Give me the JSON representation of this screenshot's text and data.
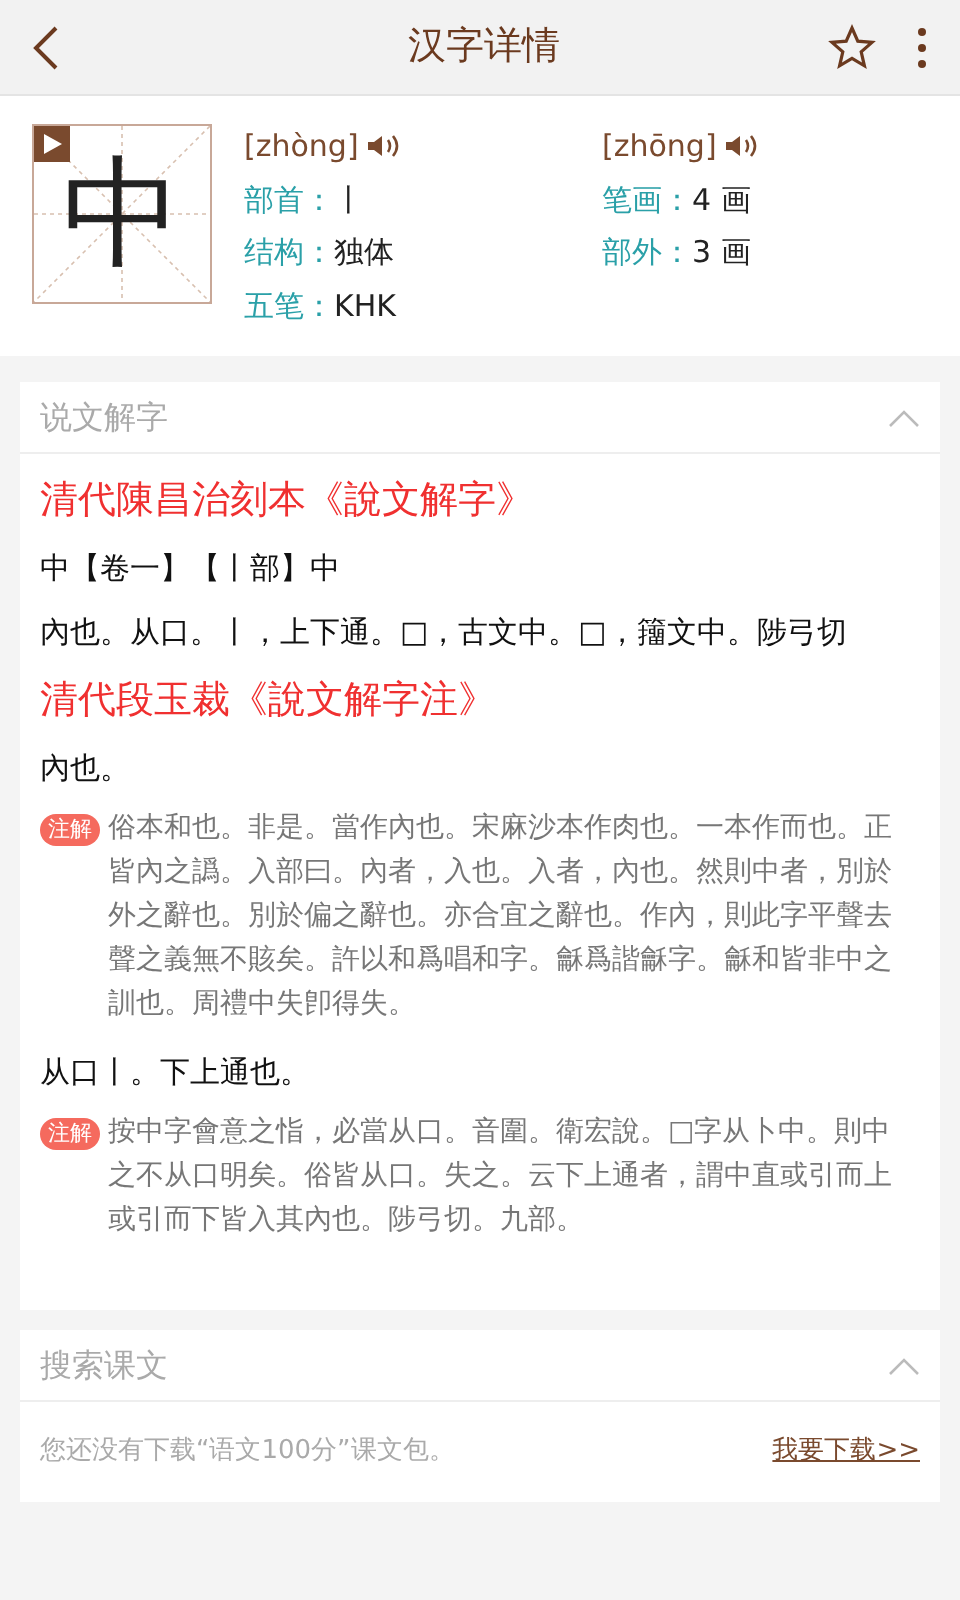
{
  "header": {
    "title": "汉字详情"
  },
  "character": {
    "glyph": "中",
    "pronunciations": [
      {
        "pinyin": "[zhòng]"
      },
      {
        "pinyin": "[zhōng]"
      }
    ],
    "fields": [
      {
        "label": "部首：",
        "value": "丨"
      },
      {
        "label": "笔画：",
        "value": "4 画"
      },
      {
        "label": "结构：",
        "value": "独体"
      },
      {
        "label": "部外：",
        "value": "3 画"
      },
      {
        "label": "五笔：",
        "value": "KHK"
      }
    ]
  },
  "shuowen": {
    "title": "说文解字",
    "expanded": true,
    "blocks": [
      {
        "kind": "heading",
        "text": "清代陳昌治刻本《說文解字》"
      },
      {
        "kind": "text",
        "text": "中【卷一】【丨部】中"
      },
      {
        "kind": "text",
        "text": "內也。从口。丨，上下通。□，古文中。□，籒文中。陟弓切"
      },
      {
        "kind": "heading",
        "text": "清代段玉裁《說文解字注》"
      },
      {
        "kind": "text",
        "text": "內也。"
      },
      {
        "kind": "note",
        "badge": "注解",
        "text": "俗本和也。非是。當作內也。宋麻沙本作肉也。一本作而也。正皆內之譌。入部曰。內者，入也。入者，內也。然則中者，別於外之辭也。別於偏之辭也。亦合宜之辭也。作內，則此字平聲去聲之義無不賅矣。許以和爲唱和字。龢爲諧龢字。龢和皆非中之訓也。周禮中失卽得失。"
      },
      {
        "kind": "text",
        "text": "从口丨。下上通也。"
      },
      {
        "kind": "note",
        "badge": "注解",
        "text": "按中字會意之恉，必當从口。音圍。衛宏說。□字从卜中。則中之不从口明矣。俗皆从口。失之。云下上通者，謂中直或引而上或引而下皆入其內也。陟弓切。九部。"
      }
    ]
  },
  "texts": {
    "title": "搜索课文",
    "expanded": true,
    "message": "您还没有下载“语文100分”课文包。",
    "link": "我要下载>>"
  }
}
